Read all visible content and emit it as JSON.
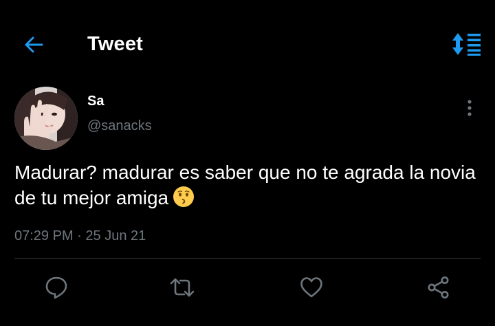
{
  "header": {
    "title": "Tweet",
    "back_icon": "back-arrow-icon",
    "sort_icon": "sort-list-icon"
  },
  "tweet": {
    "display_name": "Sa",
    "handle": "@sanacks",
    "text": "Madurar? madurar es saber que no te agrada la novia de tu mejor amiga",
    "emoji": "kissing-face-emoji",
    "time": "07:29 PM",
    "separator": " · ",
    "date": "25 Jun 21"
  },
  "actions": [
    "reply-icon",
    "retweet-icon",
    "like-icon",
    "share-icon"
  ],
  "colors": {
    "background": "#000000",
    "text": "#ffffff",
    "muted": "#6e767d",
    "accent": "#1d9bf0",
    "divider": "#2f3336"
  }
}
